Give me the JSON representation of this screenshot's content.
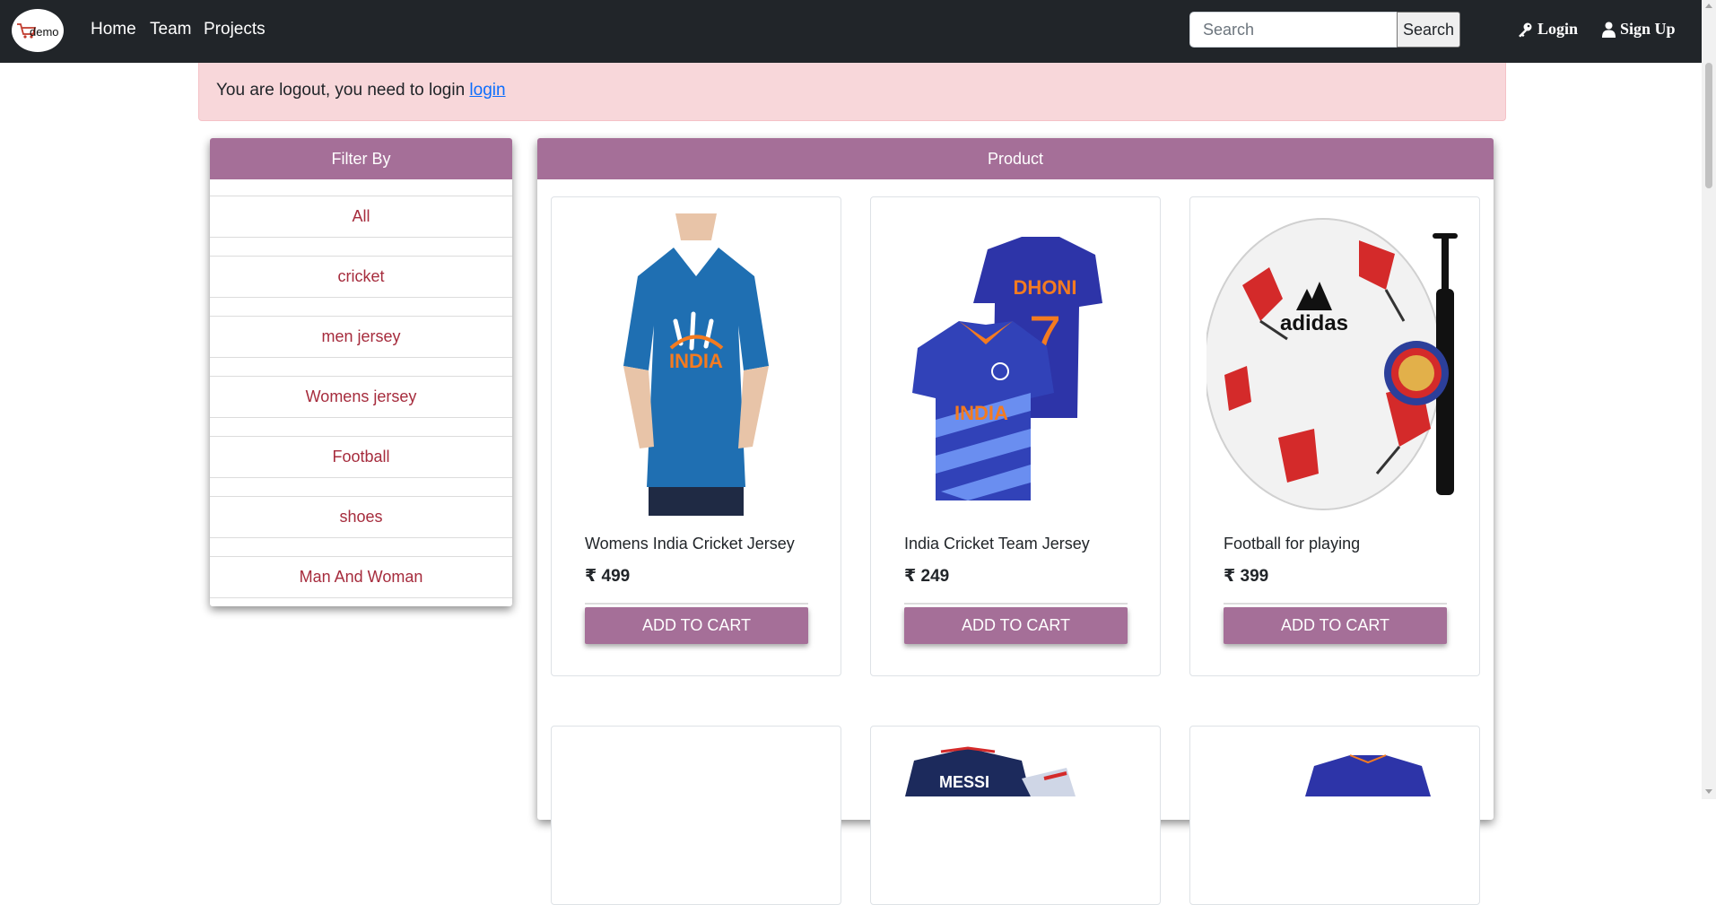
{
  "navbar": {
    "logo_text": "demo",
    "links": [
      "Home",
      "Team",
      "Projects"
    ],
    "search": {
      "placeholder": "Search",
      "button_label": "Search"
    },
    "login_label": "Login",
    "signup_label": "Sign Up"
  },
  "alert": {
    "message": "You are logout, you need to login ",
    "link_text": "login"
  },
  "filter": {
    "title": "Filter By",
    "items": [
      "All",
      "cricket",
      "men jersey",
      "Womens jersey",
      "Football",
      "shoes",
      "Man And Woman"
    ]
  },
  "products": {
    "title": "Product",
    "cards": [
      {
        "name": "Womens India Cricket Jersey",
        "price": "₹ 499",
        "button": "ADD TO CART",
        "image": "womens-blue-india-tshirt"
      },
      {
        "name": "India Cricket Team Jersey",
        "price": "₹ 249",
        "button": "ADD TO CART",
        "image": "dhoni-7-india-jersey"
      },
      {
        "name": "Football for playing",
        "price": "₹ 399",
        "button": "ADD TO CART",
        "image": "adidas-football-with-pump"
      }
    ],
    "partial_cards": [
      {
        "image": "blank"
      },
      {
        "image": "messi-jersey",
        "visible_text": "MESSI"
      },
      {
        "image": "blue-jersey"
      }
    ]
  },
  "colors": {
    "navbar_bg": "#212529",
    "accent": "#a56f98",
    "alert_bg": "#f8d7da",
    "filter_text": "#a62c3d",
    "link": "#0d6efd"
  }
}
